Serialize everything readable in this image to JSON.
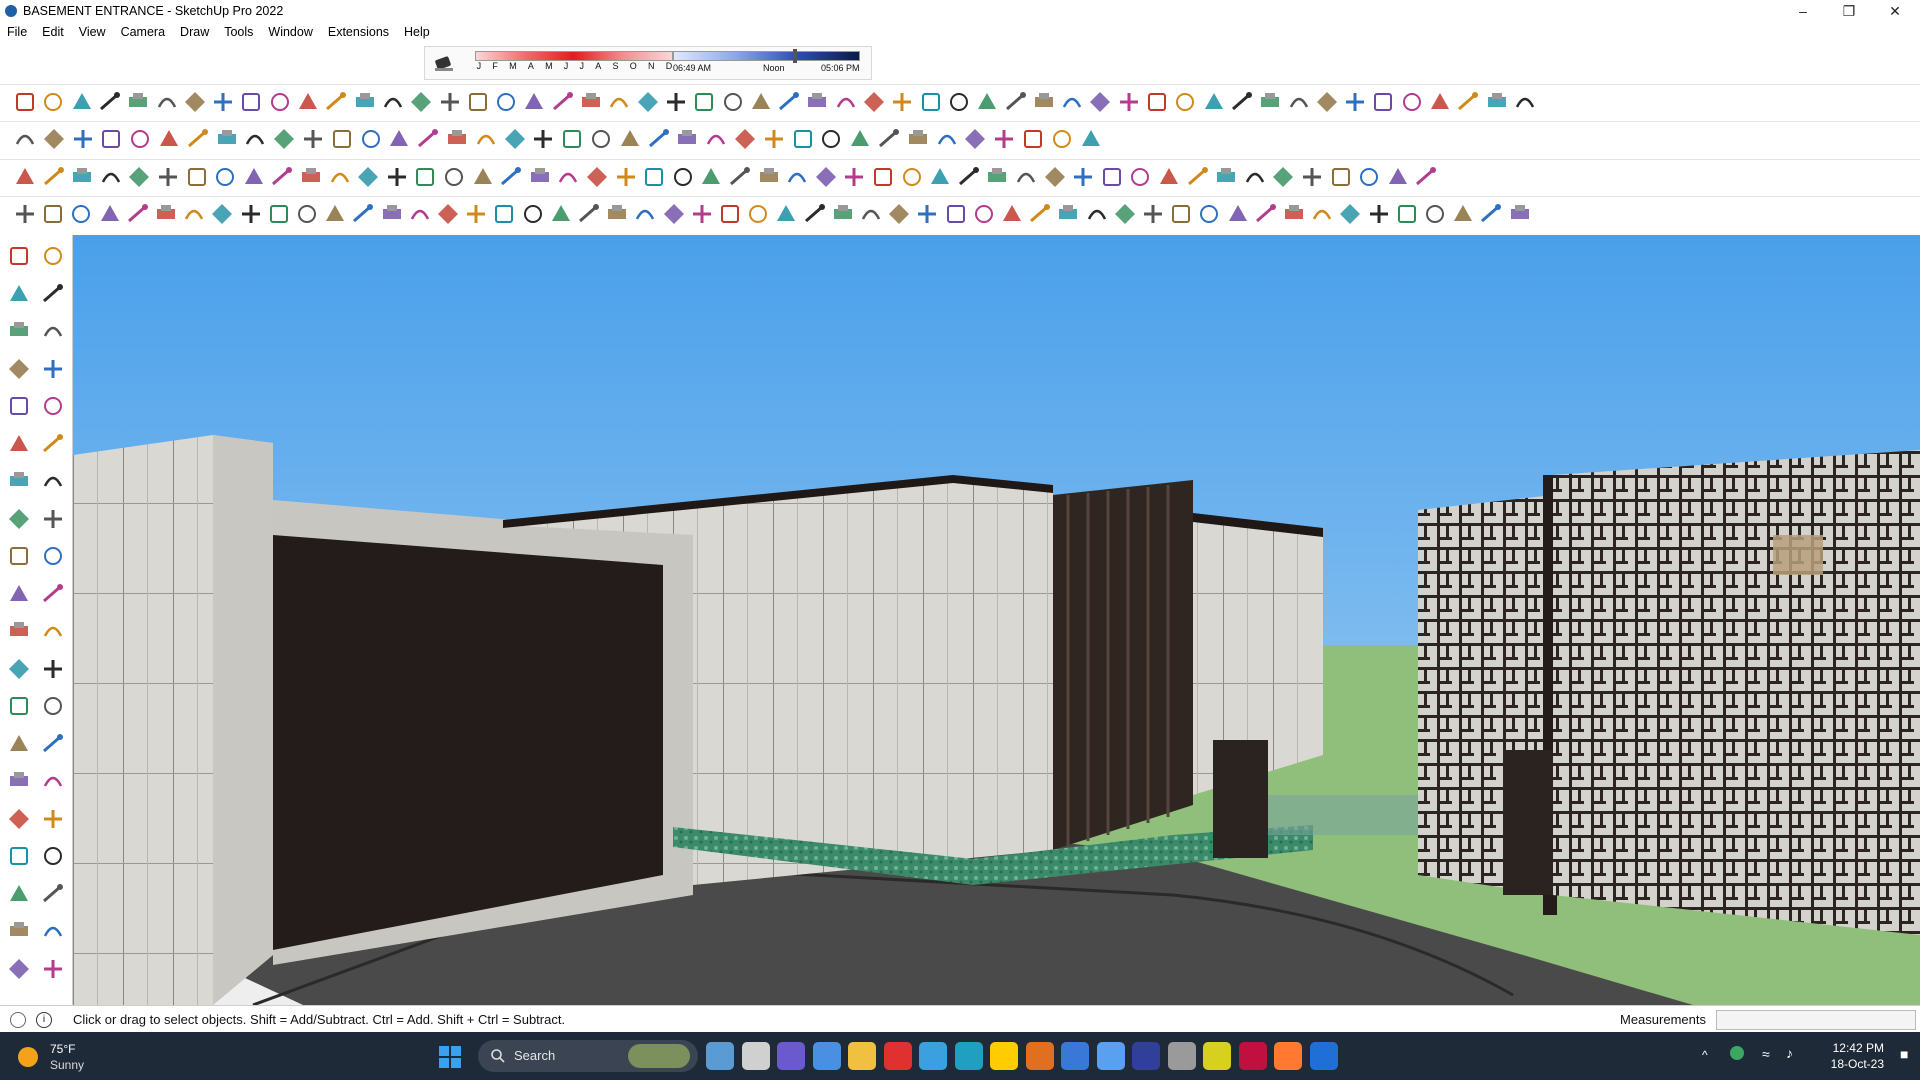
{
  "window": {
    "title": "BASEMENT ENTRANCE - SketchUp Pro 2022",
    "controls": [
      "minimize",
      "restore",
      "close"
    ]
  },
  "menu": [
    "File",
    "Edit",
    "View",
    "Camera",
    "Draw",
    "Tools",
    "Window",
    "Extensions",
    "Help"
  ],
  "shadow_settings": {
    "months": [
      "J",
      "F",
      "M",
      "A",
      "M",
      "J",
      "J",
      "A",
      "S",
      "O",
      "N",
      "D"
    ],
    "time_start": "06:49 AM",
    "time_mid": "Noon",
    "time_end": "05:06 PM"
  },
  "statusbar": {
    "hint": "Click or drag to select objects. Shift = Add/Subtract. Ctrl = Add. Shift + Ctrl = Subtract.",
    "measurements_label": "Measurements",
    "measurements_value": ""
  },
  "taskbar": {
    "temperature": "75°F",
    "condition": "Sunny",
    "search_placeholder": "Search",
    "time": "12:42 PM",
    "date": "18-Oct-23"
  },
  "colors": {
    "sky": "#7fb8ee",
    "grass": "#8fbf7a",
    "paving": "#4a4a4a",
    "stone": "#d9d7d2",
    "dark_metal": "#2b2420",
    "taskbar": "#1f2a38"
  }
}
